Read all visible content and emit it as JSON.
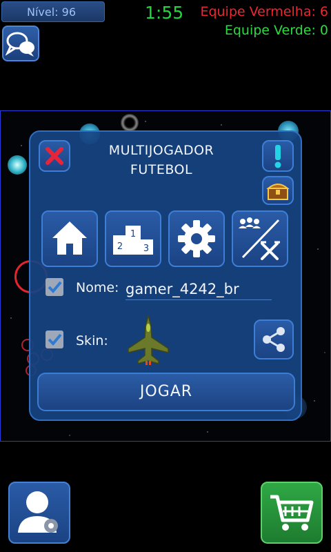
{
  "hud": {
    "level_label": "Nível: 96",
    "timer": "1:55",
    "team_red": "Equipe Vermelha: 6",
    "team_green": "Equipe Verde: 0"
  },
  "panel": {
    "title_line1": "MULTIJOGADOR",
    "title_line2": "FUTEBOL",
    "name_label": "Nome:",
    "name_value": "gamer_4242_br",
    "skin_label": "Skin:",
    "play_button": "JOGAR",
    "name_checked": true,
    "skin_checked": true
  },
  "icons": {
    "chat": "chat-bubbles-icon",
    "close": "close-x-icon",
    "alert": "exclamation-icon",
    "chest": "treasure-chest-icon",
    "home": "home-icon",
    "leaderboard": "podium-icon",
    "settings": "gear-icon",
    "mode": "team-swords-icon",
    "share": "share-icon",
    "skin": "jet-plane-icon",
    "profile": "user-settings-icon",
    "shop": "shopping-cart-icon"
  },
  "colors": {
    "red_team": "#f0262e",
    "green_team": "#2ddb40",
    "timer": "#1ed83b",
    "panel": "#174482",
    "close_red": "#e8243a",
    "alert_cyan": "#22d4e6"
  }
}
